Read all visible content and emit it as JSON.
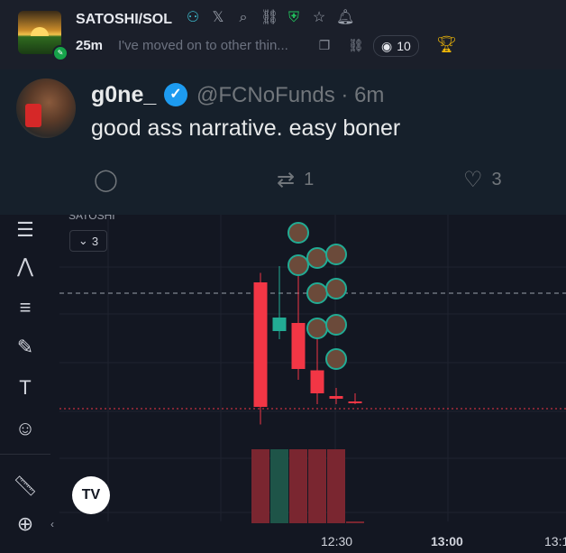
{
  "header": {
    "pair": "SATOSHI/SOL",
    "age": "25m",
    "description": "I've moved on to other thin...",
    "views": "10",
    "icons": [
      "community-icon",
      "x-icon",
      "search-icon",
      "link-icon",
      "shield-icon",
      "star-icon",
      "alert-icon"
    ]
  },
  "tweet": {
    "name": "g0ne_",
    "handle": "@FCNoFunds · 6m",
    "text": "good ass narrative. easy boner",
    "replies": "",
    "retweets": "1",
    "likes": "3"
  },
  "chart": {
    "legend": "SATOSHI",
    "indicator_count": "3",
    "x_labels": [
      "12:30",
      "13:00",
      "13:1"
    ],
    "colors": {
      "up": "#22ab94",
      "down": "#f23645",
      "vol_up": "#1e5448",
      "vol_down": "#7a2630"
    }
  },
  "chart_data": {
    "type": "candlestick",
    "x": [
      "12:14",
      "12:18",
      "12:22",
      "12:26",
      "12:30",
      "12:34"
    ],
    "open": [
      100,
      64,
      70,
      35,
      16,
      12
    ],
    "high": [
      107,
      112,
      114,
      70,
      22,
      18
    ],
    "low": [
      -5,
      58,
      28,
      10,
      10,
      10
    ],
    "close": [
      8,
      74,
      36,
      18,
      14,
      11
    ],
    "volume": [
      82,
      82,
      82,
      82,
      82,
      2
    ],
    "x_ticks": [
      "12:30",
      "13:00",
      "13:1"
    ]
  }
}
